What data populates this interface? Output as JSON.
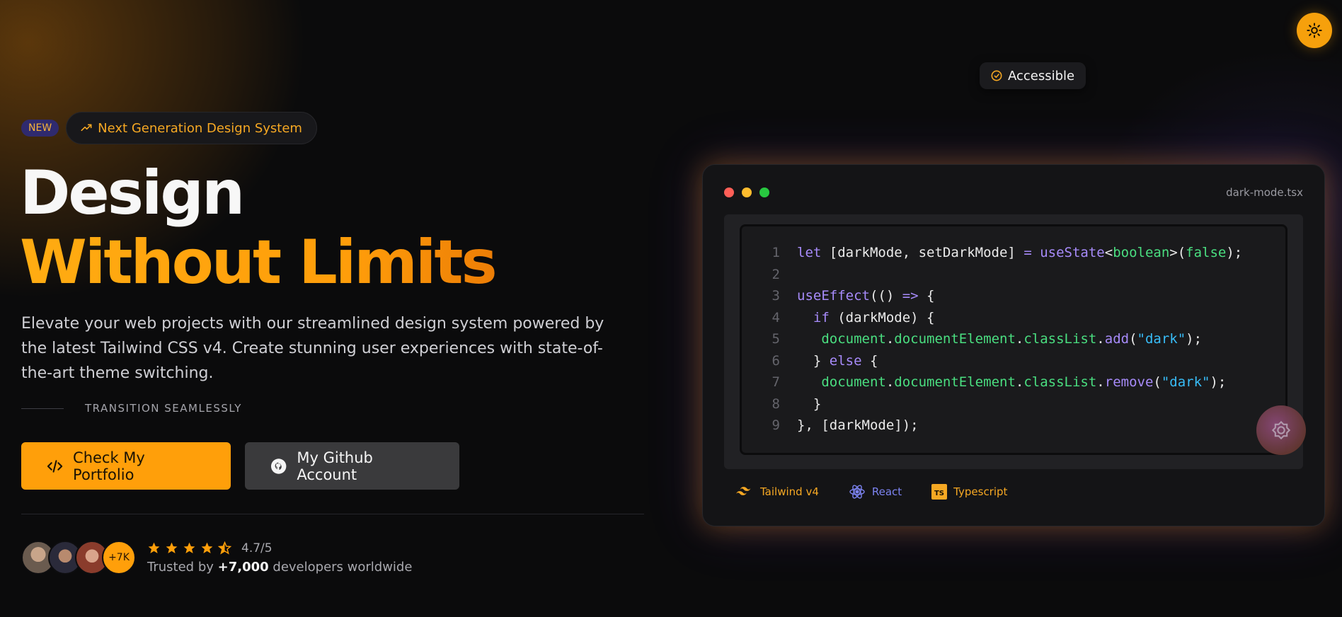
{
  "theme_toggle": {
    "icon": "sun-icon",
    "color": "#f6a00c"
  },
  "accessible_pill": {
    "label": "Accessible",
    "icon": "check-circle-icon"
  },
  "hero": {
    "new_badge": "NEW",
    "tagline": "Next Generation Design System",
    "tagline_icon": "trending-up-icon",
    "title_line1": "Design",
    "title_line2": "Without Limits",
    "description": "Elevate your web projects with our streamlined design system powered by the latest Tailwind CSS v4. Create stunning user experiences with state-of-the-art theme switching.",
    "transition_label": "TRANSITION SEAMLESSLY",
    "primary_button": "Check My Portfolio",
    "secondary_button": "My Github Account",
    "accent_color": "#ff9f0a"
  },
  "social_proof": {
    "more_badge": "+7K",
    "rating_value": 4.7,
    "rating_label": "4.7/5",
    "trusted_prefix": "Trusted by",
    "trusted_count": "+7,000",
    "trusted_suffix": "developers worldwide"
  },
  "code_window": {
    "filename": "dark-mode.tsx",
    "traffic_lights": [
      "#ff5f57",
      "#febc2e",
      "#28c840"
    ],
    "lines": [
      {
        "n": "1",
        "tokens": [
          [
            "kw",
            "let"
          ],
          [
            "t",
            " [darkMode, setDarkMode] "
          ],
          [
            "op",
            "="
          ],
          [
            "t",
            " "
          ],
          [
            "fn",
            "useState"
          ],
          [
            "t",
            "<"
          ],
          [
            "ty",
            "boolean"
          ],
          [
            "t",
            ">("
          ],
          [
            "ty",
            "false"
          ],
          [
            "t",
            ");"
          ]
        ]
      },
      {
        "n": "2",
        "tokens": []
      },
      {
        "n": "3",
        "tokens": [
          [
            "fn",
            "useEffect"
          ],
          [
            "t",
            "(() "
          ],
          [
            "op",
            "=>"
          ],
          [
            "t",
            " {"
          ]
        ]
      },
      {
        "n": "4",
        "tokens": [
          [
            "t",
            "  "
          ],
          [
            "kw",
            "if"
          ],
          [
            "t",
            " (darkMode) {"
          ]
        ]
      },
      {
        "n": "5",
        "tokens": [
          [
            "t",
            "   "
          ],
          [
            "prop",
            "document"
          ],
          [
            "t",
            "."
          ],
          [
            "prop",
            "documentElement"
          ],
          [
            "t",
            "."
          ],
          [
            "prop",
            "classList"
          ],
          [
            "t",
            "."
          ],
          [
            "fn",
            "add"
          ],
          [
            "t",
            "("
          ],
          [
            "str",
            "\"dark\""
          ],
          [
            "t",
            ");"
          ]
        ]
      },
      {
        "n": "6",
        "tokens": [
          [
            "t",
            "  } "
          ],
          [
            "kw",
            "else"
          ],
          [
            "t",
            " {"
          ]
        ]
      },
      {
        "n": "7",
        "tokens": [
          [
            "t",
            "   "
          ],
          [
            "prop",
            "document"
          ],
          [
            "t",
            "."
          ],
          [
            "prop",
            "documentElement"
          ],
          [
            "t",
            "."
          ],
          [
            "prop",
            "classList"
          ],
          [
            "t",
            "."
          ],
          [
            "fn",
            "remove"
          ],
          [
            "t",
            "("
          ],
          [
            "str",
            "\"dark\""
          ],
          [
            "t",
            ");"
          ]
        ]
      },
      {
        "n": "8",
        "tokens": [
          [
            "t",
            "  }"
          ]
        ]
      },
      {
        "n": "9",
        "tokens": [
          [
            "t",
            "}, [darkMode]);"
          ]
        ]
      }
    ],
    "tech": [
      {
        "label": "Tailwind v4",
        "icon": "tailwind-icon"
      },
      {
        "label": "React",
        "icon": "react-icon"
      },
      {
        "label": "Typescript",
        "icon": "typescript-icon"
      }
    ]
  }
}
